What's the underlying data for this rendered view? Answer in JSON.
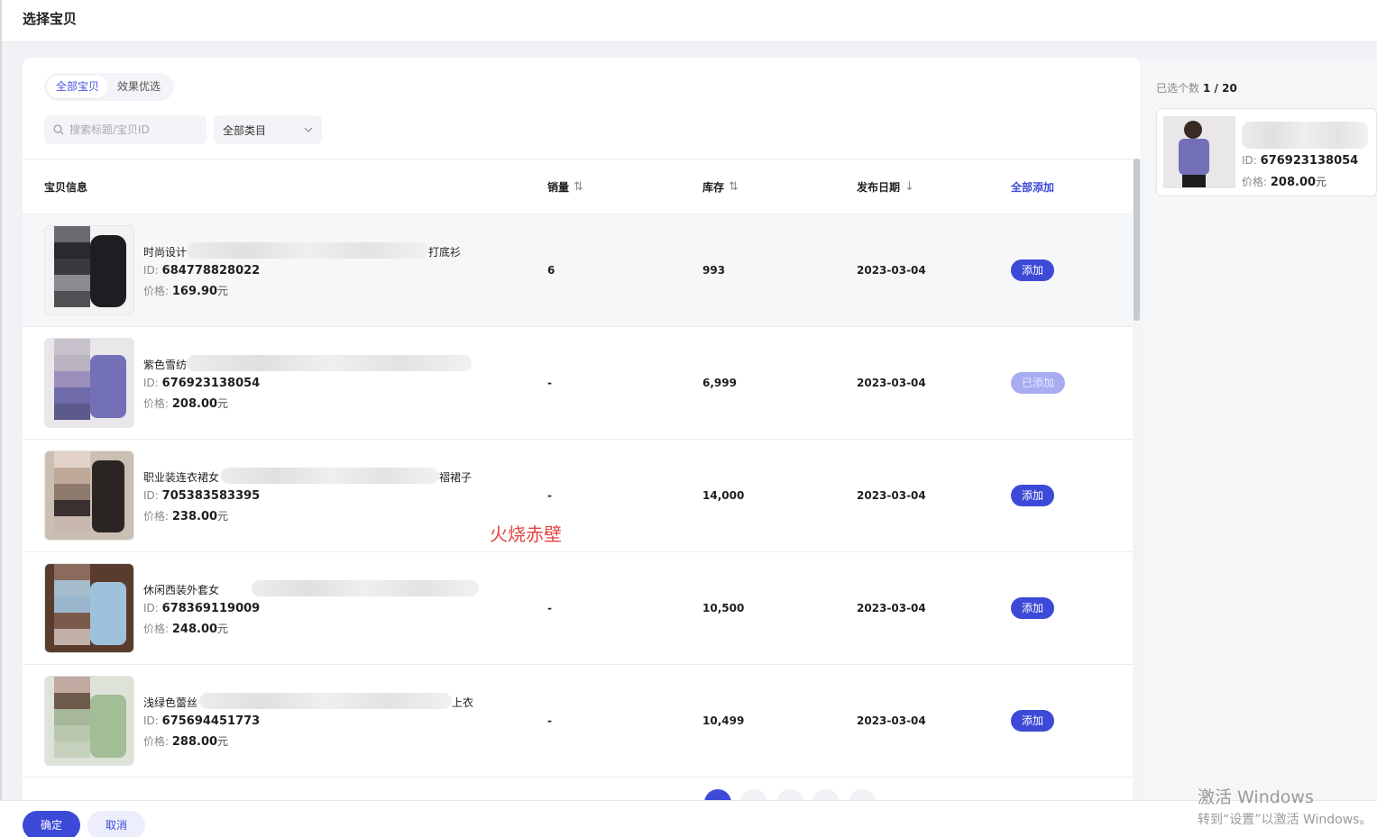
{
  "dialog": {
    "title": "选择宝贝"
  },
  "tabs": [
    {
      "label": "全部宝贝",
      "active": true
    },
    {
      "label": "效果优选",
      "active": false
    }
  ],
  "search": {
    "placeholder": "搜索标题/宝贝ID"
  },
  "category_select": {
    "value": "全部类目"
  },
  "table": {
    "columns": {
      "info": "宝贝信息",
      "sales": "销量",
      "stock": "库存",
      "date": "发布日期",
      "add_all": "全部添加"
    },
    "id_label": "ID:",
    "price_label": "价格:",
    "price_unit": "元",
    "rows": [
      {
        "title_start": "时尚设计",
        "title_end": "打底衫",
        "id": "684778828022",
        "price": "169.90",
        "sales": "6",
        "stock": "993",
        "date": "2023-03-04",
        "action": "添加",
        "added": false
      },
      {
        "title_start": "紫色雪纺",
        "title_end": "",
        "id": "676923138054",
        "price": "208.00",
        "sales": "-",
        "stock": "6,999",
        "date": "2023-03-04",
        "action": "已添加",
        "added": true
      },
      {
        "title_start": "职业装连衣裙女",
        "title_end": "褶裙子",
        "id": "705383583395",
        "price": "238.00",
        "sales": "-",
        "stock": "14,000",
        "date": "2023-03-04",
        "action": "添加",
        "added": false
      },
      {
        "title_start": "休闲西装外套女",
        "title_end": "",
        "id": "678369119009",
        "price": "248.00",
        "sales": "-",
        "stock": "10,500",
        "date": "2023-03-04",
        "action": "添加",
        "added": false
      },
      {
        "title_start": "浅绿色蕾丝",
        "title_end": "上衣",
        "id": "675694451773",
        "price": "288.00",
        "sales": "-",
        "stock": "10,499",
        "date": "2023-03-04",
        "action": "添加",
        "added": false
      }
    ]
  },
  "selected": {
    "count_label": "已选个数",
    "count": "1 / 20",
    "items": [
      {
        "id": "676923138054",
        "price": "208.00"
      }
    ]
  },
  "overlay_text": "火烧赤壁",
  "footer": {
    "confirm": "确定",
    "cancel": "取消"
  },
  "os_watermark": {
    "line1": "激活 Windows",
    "line2": "转到“设置”以激活 Windows。"
  }
}
